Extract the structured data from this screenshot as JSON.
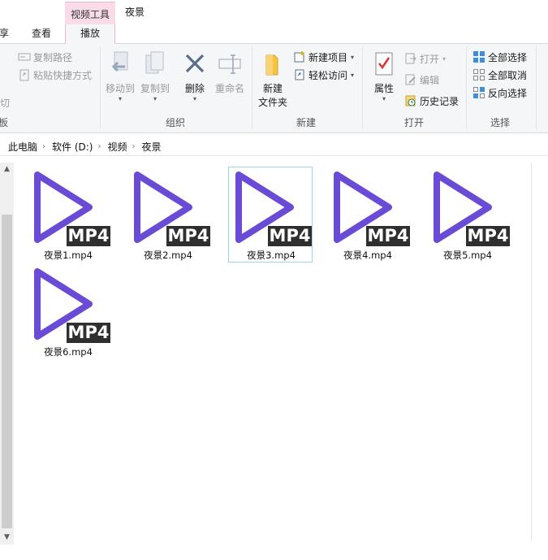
{
  "window": {
    "context_group": "视频工具",
    "title": "夜景"
  },
  "tabs": [
    {
      "label": "享"
    },
    {
      "label": "查看"
    },
    {
      "label": "播放"
    }
  ],
  "ribbon": {
    "clipboard": {
      "copy_path": "复制路径",
      "paste_shortcut": "粘贴快捷方式",
      "cut": "剪切",
      "label": "板"
    },
    "organize": {
      "move_to": "移动到",
      "copy_to": "复制到",
      "delete": "删除",
      "rename": "重命名",
      "label": "组织"
    },
    "new": {
      "new_folder_line1": "新建",
      "new_folder_line2": "文件夹",
      "new_item": "新建项目",
      "easy_access": "轻松访问",
      "label": "新建"
    },
    "open": {
      "properties": "属性",
      "open": "打开",
      "edit": "编辑",
      "history": "历史记录",
      "label": "打开"
    },
    "select": {
      "select_all": "全部选择",
      "select_none": "全部取消",
      "invert": "反向选择",
      "label": "选择"
    }
  },
  "breadcrumb": [
    "此电脑",
    "软件 (D:)",
    "视频",
    "夜景"
  ],
  "files": [
    {
      "name": "夜景1.mp4",
      "badge": "MP4",
      "selected": false
    },
    {
      "name": "夜景2.mp4",
      "badge": "MP4",
      "selected": false
    },
    {
      "name": "夜景3.mp4",
      "badge": "MP4",
      "selected": true
    },
    {
      "name": "夜景4.mp4",
      "badge": "MP4",
      "selected": false
    },
    {
      "name": "夜景5.mp4",
      "badge": "MP4",
      "selected": false
    },
    {
      "name": "夜景6.mp4",
      "badge": "MP4",
      "selected": false
    }
  ],
  "colors": {
    "play_icon": "#6a4bd6",
    "badge_bg": "#2f2f2f",
    "selection_border": "#99d1ff",
    "context_tab": "#f9dbe9"
  }
}
